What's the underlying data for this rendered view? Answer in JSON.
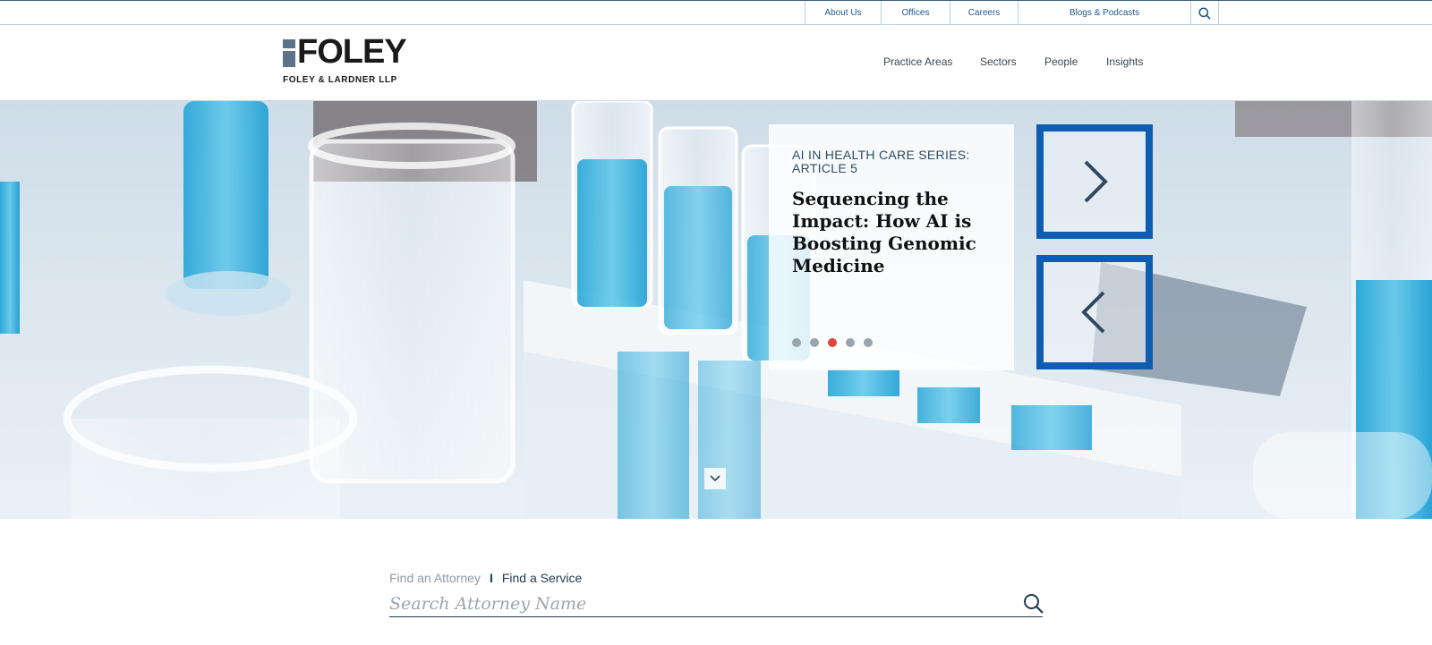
{
  "utility_nav": {
    "links": [
      "About Us",
      "Offices",
      "Careers",
      "Blogs & Podcasts"
    ],
    "search_icon": "search-icon"
  },
  "brand": {
    "wordmark": "FOLEY",
    "subtitle": "FOLEY & LARDNER LLP"
  },
  "main_nav": {
    "items": [
      "Practice Areas",
      "Sectors",
      "People",
      "Insights"
    ]
  },
  "hero": {
    "series": "AI IN HEALTH CARE SERIES: ARTICLE 5",
    "title": "Sequencing the Impact: How AI is Boosting Genomic Medicine",
    "slide_count": 5,
    "active_slide": 3,
    "next_icon": "chevron-right-icon",
    "prev_icon": "chevron-left-icon",
    "scroll_icon": "chevron-down-icon"
  },
  "finder": {
    "tabs": [
      "Find an Attorney",
      "Find a Service"
    ],
    "active_tab": "Find a Service",
    "placeholder": "Search Attorney Name",
    "search_icon": "search-icon"
  },
  "colors": {
    "accent_blue": "#0f5db3",
    "navy": "#1d3a55",
    "active_dot": "#e0463c"
  }
}
